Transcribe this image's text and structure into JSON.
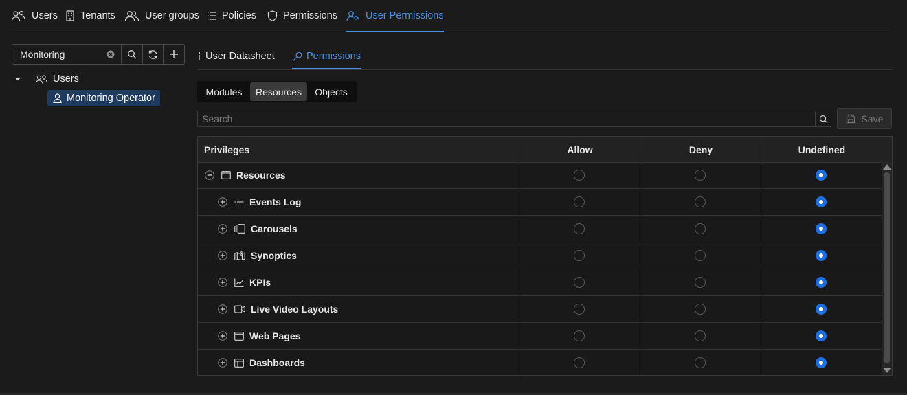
{
  "nav": {
    "items": [
      {
        "label": "Users",
        "icon": "users-icon"
      },
      {
        "label": "Tenants",
        "icon": "building-icon"
      },
      {
        "label": "User groups",
        "icon": "user-group-icon"
      },
      {
        "label": "Policies",
        "icon": "list-icon"
      },
      {
        "label": "Permissions",
        "icon": "shield-icon"
      },
      {
        "label": "User Permissions",
        "icon": "user-key-icon",
        "active": true
      }
    ]
  },
  "sidebar": {
    "search_value": "Monitoring",
    "tree": {
      "root_label": "Users",
      "child_label": "Monitoring Operator"
    }
  },
  "content_tabs": [
    {
      "label": "User Datasheet",
      "icon": "info-icon"
    },
    {
      "label": "Permissions",
      "icon": "key-icon",
      "active": true
    }
  ],
  "segments": [
    {
      "label": "Modules"
    },
    {
      "label": "Resources",
      "active": true
    },
    {
      "label": "Objects"
    }
  ],
  "search": {
    "placeholder": "Search"
  },
  "save_label": "Save",
  "table": {
    "headers": {
      "privileges": "Privileges",
      "allow": "Allow",
      "deny": "Deny",
      "undefined": "Undefined"
    },
    "rows": [
      {
        "label": "Resources",
        "icon": "window-icon",
        "expanded": true,
        "level": 0,
        "value": "undefined"
      },
      {
        "label": "Events Log",
        "icon": "list-icon",
        "level": 1,
        "value": "undefined"
      },
      {
        "label": "Carousels",
        "icon": "carousel-icon",
        "level": 1,
        "value": "undefined"
      },
      {
        "label": "Synoptics",
        "icon": "map-icon",
        "level": 1,
        "value": "undefined"
      },
      {
        "label": "KPIs",
        "icon": "chart-line-icon",
        "level": 1,
        "value": "undefined"
      },
      {
        "label": "Live Video Layouts",
        "icon": "video-icon",
        "level": 1,
        "value": "undefined"
      },
      {
        "label": "Web Pages",
        "icon": "browser-icon",
        "level": 1,
        "value": "undefined"
      },
      {
        "label": "Dashboards",
        "icon": "dashboard-icon",
        "level": 1,
        "value": "undefined"
      }
    ]
  },
  "colors": {
    "accent": "#4a90e6",
    "radio_checked": "#1f6fe0",
    "selected_bg": "#1e3a5f",
    "background": "#1b1b1b"
  }
}
